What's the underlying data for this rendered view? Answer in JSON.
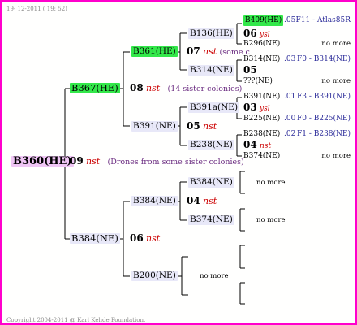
{
  "stamp": "19- 12-2011 ( 19: 52)",
  "copyright": "Copyright 2004-2011 @ Karl Kehde Foundation.",
  "colors": {
    "frame": "#ff00cc",
    "green": "#33e84a",
    "purple": "#f0c6f5",
    "nst": "#cc0000"
  },
  "root": {
    "label": "B360(HE)",
    "gen": "09",
    "nst": "nst",
    "note": "(Drones from some sister colonies)"
  },
  "gen1": {
    "a": {
      "label": "B367(HE)",
      "gen": "08",
      "nst": "nst",
      "note": "(14 sister colonies)"
    },
    "b": {
      "label": "B384(NE)",
      "gen": "06",
      "nst": "nst"
    }
  },
  "gen2": {
    "a": {
      "label": "B361(HE)",
      "gen": "07",
      "nst": "nst",
      "note": "(some c"
    },
    "b": {
      "label": "B391(NE)",
      "gen": "05",
      "nst": "nst"
    },
    "c": {
      "label": "B384(NE)",
      "gen": "04",
      "nst": "nst"
    },
    "d": {
      "label": "B200(NE)",
      "nomore": "no more"
    }
  },
  "gen3": {
    "a": {
      "label": "B136(HE)",
      "gen": "06",
      "tag": "ysl"
    },
    "b": {
      "label": "B314(NE)",
      "gen": "05"
    },
    "c": {
      "label": "B391a(NE)",
      "gen": "03",
      "tag": "ysl"
    },
    "d": {
      "label": "B238(NE)",
      "gen": "04",
      "tag": "nst"
    },
    "e": {
      "label": "B384(NE)",
      "nomore": "no more"
    },
    "f": {
      "label": "B374(NE)",
      "nomore": "no more"
    }
  },
  "gen4": [
    {
      "label": "B409(HE)",
      "mark": ".05",
      "ref": "F11 - Atlas85R"
    },
    {
      "label": "B296(NE)",
      "ref": "no more"
    },
    {
      "label": "B314(NE)",
      "mark": ".03",
      "ref": "F0 - B314(NE)"
    },
    {
      "label": "???(NE)",
      "ref": "no more"
    },
    {
      "label": "B391(NE)",
      "mark": ".01",
      "ref": "F3 - B391(NE)"
    },
    {
      "label": "B225(NE)",
      "mark": ".00",
      "ref": "F0 - B225(NE)"
    },
    {
      "label": "B238(NE)",
      "mark": ".02",
      "ref": "F1 - B238(NE)"
    },
    {
      "label": "B374(NE)",
      "ref": "no more"
    }
  ]
}
